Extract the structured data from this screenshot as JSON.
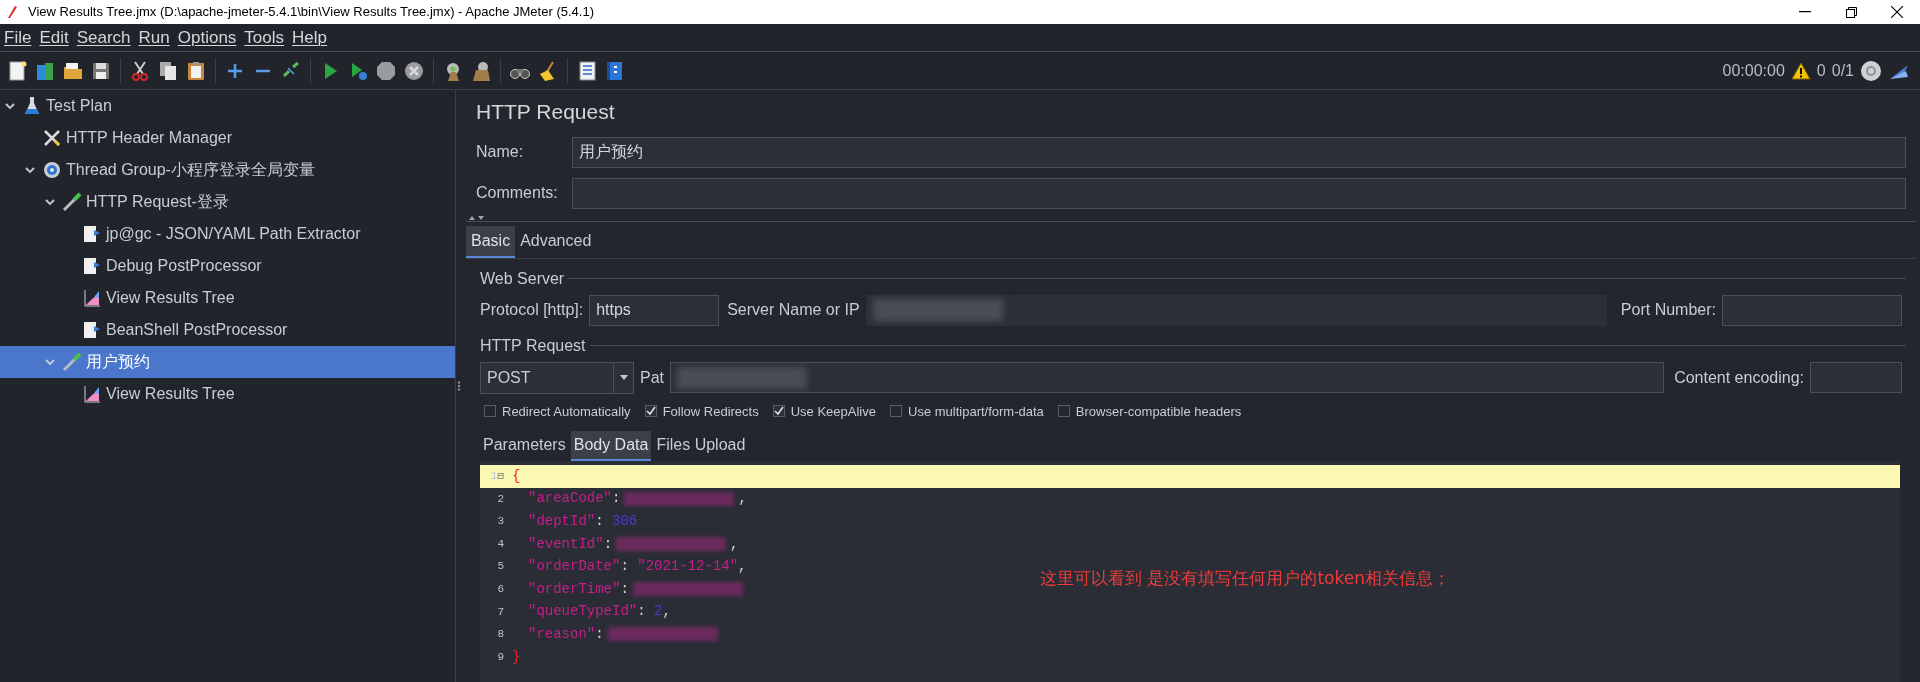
{
  "window": {
    "title": "View Results Tree.jmx (D:\\apache-jmeter-5.4.1\\bin\\View Results Tree.jmx) - Apache JMeter (5.4.1)"
  },
  "menu": [
    {
      "label": "File"
    },
    {
      "label": "Edit"
    },
    {
      "label": "Search"
    },
    {
      "label": "Run"
    },
    {
      "label": "Options"
    },
    {
      "label": "Tools"
    },
    {
      "label": "Help"
    }
  ],
  "status": {
    "timer": "00:00:00",
    "warnings": "0",
    "threads": "0/1"
  },
  "tree": [
    {
      "label": "Test Plan",
      "kind": "plan",
      "expanded": true,
      "selected": false,
      "children": [
        {
          "label": "HTTP Header Manager",
          "kind": "config",
          "selected": false
        },
        {
          "label": "Thread Group-小程序登录全局变量",
          "kind": "thread",
          "expanded": true,
          "selected": false,
          "children": [
            {
              "label": "HTTP Request-登录",
              "kind": "sampler",
              "expanded": true,
              "selected": false,
              "children": [
                {
                  "label": "jp@gc - JSON/YAML Path Extractor",
                  "kind": "post",
                  "selected": false
                },
                {
                  "label": "Debug PostProcessor",
                  "kind": "post",
                  "selected": false
                },
                {
                  "label": "View Results Tree",
                  "kind": "listener",
                  "selected": false
                },
                {
                  "label": "BeanShell PostProcessor",
                  "kind": "post",
                  "selected": false
                }
              ]
            },
            {
              "label": "用户预约",
              "kind": "sampler",
              "expanded": true,
              "selected": true,
              "children": [
                {
                  "label": "View Results Tree",
                  "kind": "listener",
                  "selected": false
                }
              ]
            }
          ]
        }
      ]
    }
  ],
  "panel": {
    "title": "HTTP Request",
    "name_label": "Name:",
    "name_value": "用户预约",
    "comments_label": "Comments:",
    "tabs": [
      {
        "label": "Basic",
        "selected": true
      },
      {
        "label": "Advanced",
        "selected": false
      }
    ],
    "web_server": {
      "legend": "Web Server",
      "protocol_label": "Protocol [http]:",
      "protocol_value": "https",
      "server_label": "Server Name or IP",
      "server_redacted": true,
      "port_label": "Port Number:"
    },
    "http_request": {
      "legend": "HTTP Request",
      "method": "POST",
      "path_label": "Pat",
      "path_redacted": true,
      "encoding_label": "Content encoding:"
    },
    "options": [
      {
        "label": "Redirect Automatically",
        "checked": false
      },
      {
        "label": "Follow Redirects",
        "checked": true
      },
      {
        "label": "Use KeepAlive",
        "checked": true
      },
      {
        "label": "Use multipart/form-data",
        "checked": false
      },
      {
        "label": "Browser-compatible headers",
        "checked": false
      }
    ],
    "body_tabs": [
      {
        "label": "Parameters",
        "selected": false
      },
      {
        "label": "Body Data",
        "selected": true
      },
      {
        "label": "Files Upload",
        "selected": false
      }
    ],
    "code": [
      {
        "number": "1",
        "fold": "⊟",
        "highlighted": true,
        "tokens": [
          {
            "kind": "brace",
            "text": "{"
          }
        ]
      },
      {
        "number": "2",
        "highlighted": false,
        "tokens": [
          {
            "kind": "key",
            "text": "\"areaCode\""
          },
          {
            "kind": "punct",
            "text": ":"
          },
          {
            "kind": "redacted"
          },
          {
            "kind": "punct",
            "text": ","
          }
        ]
      },
      {
        "number": "3",
        "highlighted": false,
        "tokens": [
          {
            "kind": "key",
            "text": "\"deptId\""
          },
          {
            "kind": "punct",
            "text": ": "
          },
          {
            "kind": "number",
            "text": "306"
          }
        ]
      },
      {
        "number": "4",
        "highlighted": false,
        "tokens": [
          {
            "kind": "key",
            "text": "\"eventId\""
          },
          {
            "kind": "punct",
            "text": ":"
          },
          {
            "kind": "redacted"
          },
          {
            "kind": "punct",
            "text": ","
          }
        ]
      },
      {
        "number": "5",
        "highlighted": false,
        "tokens": [
          {
            "kind": "key",
            "text": "\"orderDate\""
          },
          {
            "kind": "punct",
            "text": ": "
          },
          {
            "kind": "string",
            "text": "\"2021-12-14\""
          },
          {
            "kind": "punct",
            "text": ","
          }
        ]
      },
      {
        "number": "6",
        "highlighted": false,
        "tokens": [
          {
            "kind": "key",
            "text": "\"orderTime\""
          },
          {
            "kind": "punct",
            "text": ":"
          },
          {
            "kind": "redacted"
          }
        ]
      },
      {
        "number": "7",
        "highlighted": false,
        "tokens": [
          {
            "kind": "key",
            "text": "\"queueTypeId\""
          },
          {
            "kind": "punct",
            "text": ": "
          },
          {
            "kind": "number",
            "text": "2"
          },
          {
            "kind": "punct",
            "text": ","
          }
        ]
      },
      {
        "number": "8",
        "highlighted": false,
        "tokens": [
          {
            "kind": "key",
            "text": "\"reason\""
          },
          {
            "kind": "punct",
            "text": ":"
          },
          {
            "kind": "redacted"
          }
        ]
      },
      {
        "number": "9",
        "highlighted": false,
        "tokens": [
          {
            "kind": "brace",
            "text": "}"
          }
        ]
      }
    ],
    "annotation": "这里可以看到 是没有填写任何用户的token相关信息；"
  }
}
